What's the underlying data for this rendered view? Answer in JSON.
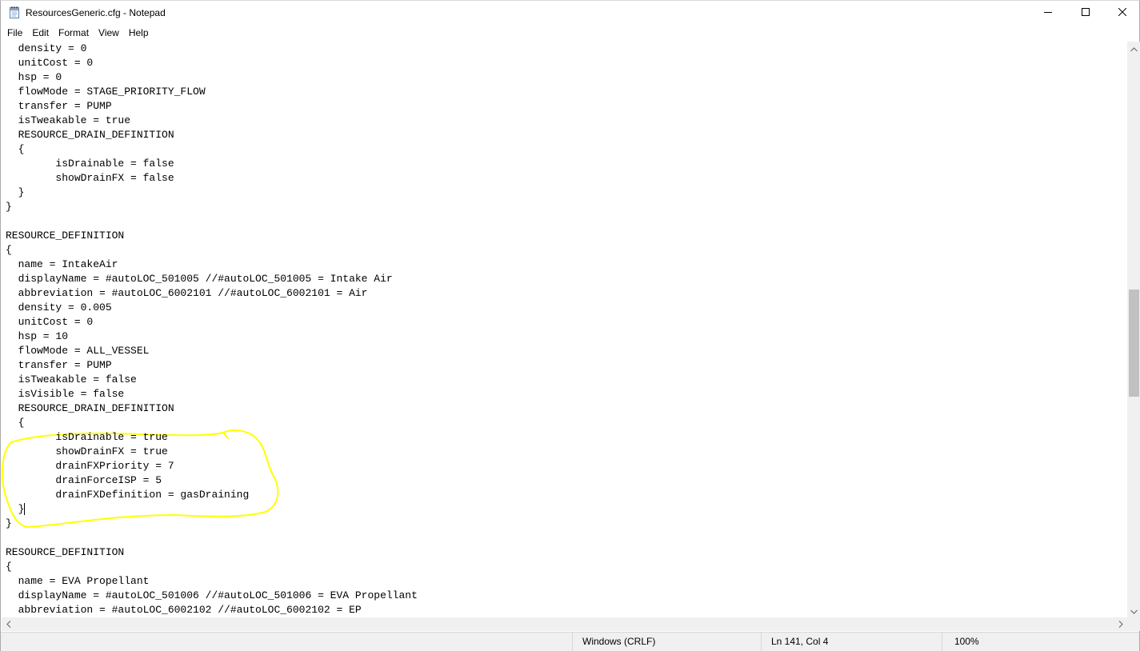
{
  "window": {
    "title": "ResourcesGeneric.cfg - Notepad",
    "app_icon": "notepad-icon"
  },
  "caption_buttons": {
    "minimize": "minimize-icon",
    "maximize": "maximize-icon",
    "close": "close-icon"
  },
  "menu": {
    "items": [
      "File",
      "Edit",
      "Format",
      "View",
      "Help"
    ]
  },
  "editor": {
    "lines": [
      "  density = 0",
      "  unitCost = 0",
      "  hsp = 0",
      "  flowMode = STAGE_PRIORITY_FLOW",
      "  transfer = PUMP",
      "  isTweakable = true",
      "  RESOURCE_DRAIN_DEFINITION",
      "  {",
      "        isDrainable = false",
      "        showDrainFX = false",
      "  }",
      "}",
      "",
      "RESOURCE_DEFINITION",
      "{",
      "  name = IntakeAir",
      "  displayName = #autoLOC_501005 //#autoLOC_501005 = Intake Air",
      "  abbreviation = #autoLOC_6002101 //#autoLOC_6002101 = Air",
      "  density = 0.005",
      "  unitCost = 0",
      "  hsp = 10",
      "  flowMode = ALL_VESSEL",
      "  transfer = PUMP",
      "  isTweakable = false",
      "  isVisible = false",
      "  RESOURCE_DRAIN_DEFINITION",
      "  {",
      "        isDrainable = true",
      "        showDrainFX = true",
      "        drainFXPriority = 7",
      "        drainForceISP = 5",
      "        drainFXDefinition = gasDraining",
      "  }",
      "}",
      "",
      "RESOURCE_DEFINITION",
      "{",
      "  name = EVA Propellant",
      "  displayName = #autoLOC_501006 //#autoLOC_501006 = EVA Propellant",
      "  abbreviation = #autoLOC_6002102 //#autoLOC_6002102 = EP"
    ],
    "caret_line": 32,
    "annotation_color": "#ffff00",
    "vertical_scroll_position": 0.53
  },
  "statusbar": {
    "encoding": "Windows (CRLF)",
    "position": "Ln 141, Col 4",
    "zoom": "100%"
  }
}
